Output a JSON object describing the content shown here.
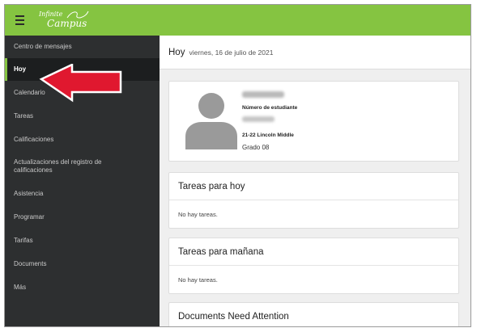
{
  "app": {
    "logo_line1": "Infinite",
    "logo_line2": "Campus",
    "brand_color": "#85c441"
  },
  "sidebar": {
    "items": [
      {
        "label": "Centro de mensajes",
        "active": false
      },
      {
        "label": "Hoy",
        "active": true
      },
      {
        "label": "Calendario",
        "active": false
      },
      {
        "label": "Tareas",
        "active": false
      },
      {
        "label": "Calificaciones",
        "active": false
      },
      {
        "label": "Actualizaciones del registro de calificaciones",
        "active": false
      },
      {
        "label": "Asistencia",
        "active": false
      },
      {
        "label": "Programar",
        "active": false
      },
      {
        "label": "Tarifas",
        "active": false
      },
      {
        "label": "Documents",
        "active": false
      },
      {
        "label": "Más",
        "active": false
      }
    ]
  },
  "header": {
    "title": "Hoy",
    "date": "viernes, 16 de julio de 2021"
  },
  "profile": {
    "student_number_label": "Número de estudiante",
    "school": "21-22 Lincoln Middle",
    "grade": "Grado 08"
  },
  "sections": [
    {
      "title": "Tareas para hoy",
      "body": "No hay tareas."
    },
    {
      "title": "Tareas para mañana",
      "body": "No hay tareas."
    },
    {
      "title": "Documents Need Attention"
    }
  ],
  "annotation": {
    "arrow_color": "#e0182f"
  }
}
